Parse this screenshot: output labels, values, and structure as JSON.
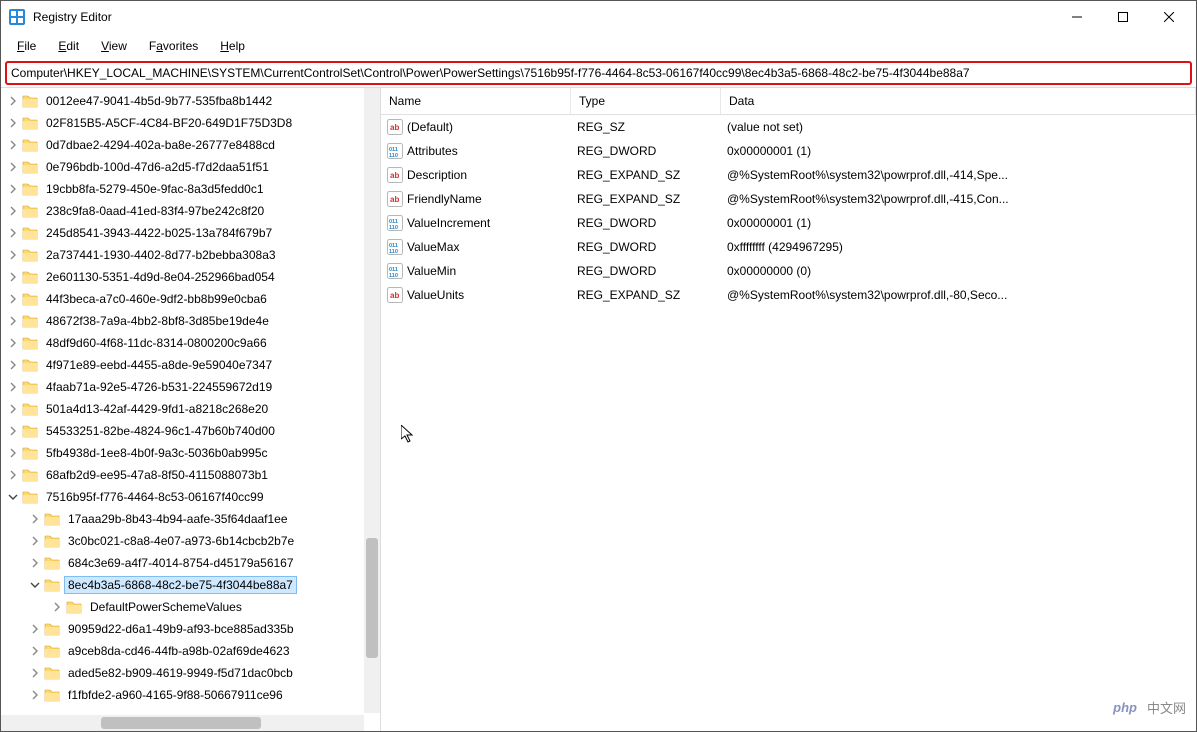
{
  "window": {
    "title": "Registry Editor"
  },
  "menu": {
    "file": "File",
    "edit": "Edit",
    "view": "View",
    "favorites": "Favorites",
    "help": "Help"
  },
  "address": "Computer\\HKEY_LOCAL_MACHINE\\SYSTEM\\CurrentControlSet\\Control\\Power\\PowerSettings\\7516b95f-f776-4464-8c53-06167f40cc99\\8ec4b3a5-6868-48c2-be75-4f3044be88a7",
  "tree": [
    {
      "label": "0012ee47-9041-4b5d-9b77-535fba8b1442",
      "indent": 1,
      "chev": "r"
    },
    {
      "label": "02F815B5-A5CF-4C84-BF20-649D1F75D3D8",
      "indent": 1,
      "chev": "r"
    },
    {
      "label": "0d7dbae2-4294-402a-ba8e-26777e8488cd",
      "indent": 1,
      "chev": "r"
    },
    {
      "label": "0e796bdb-100d-47d6-a2d5-f7d2daa51f51",
      "indent": 1,
      "chev": "r"
    },
    {
      "label": "19cbb8fa-5279-450e-9fac-8a3d5fedd0c1",
      "indent": 1,
      "chev": "r"
    },
    {
      "label": "238c9fa8-0aad-41ed-83f4-97be242c8f20",
      "indent": 1,
      "chev": "r"
    },
    {
      "label": "245d8541-3943-4422-b025-13a784f679b7",
      "indent": 1,
      "chev": "r"
    },
    {
      "label": "2a737441-1930-4402-8d77-b2bebba308a3",
      "indent": 1,
      "chev": "r"
    },
    {
      "label": "2e601130-5351-4d9d-8e04-252966bad054",
      "indent": 1,
      "chev": "r"
    },
    {
      "label": "44f3beca-a7c0-460e-9df2-bb8b99e0cba6",
      "indent": 1,
      "chev": "r"
    },
    {
      "label": "48672f38-7a9a-4bb2-8bf8-3d85be19de4e",
      "indent": 1,
      "chev": "r"
    },
    {
      "label": "48df9d60-4f68-11dc-8314-0800200c9a66",
      "indent": 1,
      "chev": "r"
    },
    {
      "label": "4f971e89-eebd-4455-a8de-9e59040e7347",
      "indent": 1,
      "chev": "r"
    },
    {
      "label": "4faab71a-92e5-4726-b531-224559672d19",
      "indent": 1,
      "chev": "r"
    },
    {
      "label": "501a4d13-42af-4429-9fd1-a8218c268e20",
      "indent": 1,
      "chev": "r"
    },
    {
      "label": "54533251-82be-4824-96c1-47b60b740d00",
      "indent": 1,
      "chev": "r"
    },
    {
      "label": "5fb4938d-1ee8-4b0f-9a3c-5036b0ab995c",
      "indent": 1,
      "chev": "r"
    },
    {
      "label": "68afb2d9-ee95-47a8-8f50-4115088073b1",
      "indent": 1,
      "chev": "r"
    },
    {
      "label": "7516b95f-f776-4464-8c53-06167f40cc99",
      "indent": 1,
      "chev": "d"
    },
    {
      "label": "17aaa29b-8b43-4b94-aafe-35f64daaf1ee",
      "indent": 2,
      "chev": "r"
    },
    {
      "label": "3c0bc021-c8a8-4e07-a973-6b14cbcb2b7e",
      "indent": 2,
      "chev": "r"
    },
    {
      "label": "684c3e69-a4f7-4014-8754-d45179a56167",
      "indent": 2,
      "chev": "r"
    },
    {
      "label": "8ec4b3a5-6868-48c2-be75-4f3044be88a7",
      "indent": 2,
      "chev": "d",
      "selected": true
    },
    {
      "label": "DefaultPowerSchemeValues",
      "indent": 3,
      "chev": "r"
    },
    {
      "label": "90959d22-d6a1-49b9-af93-bce885ad335b",
      "indent": 2,
      "chev": "r"
    },
    {
      "label": "a9ceb8da-cd46-44fb-a98b-02af69de4623",
      "indent": 2,
      "chev": "r"
    },
    {
      "label": "aded5e82-b909-4619-9949-f5d71dac0bcb",
      "indent": 2,
      "chev": "r"
    },
    {
      "label": "f1fbfde2-a960-4165-9f88-50667911ce96",
      "indent": 2,
      "chev": "r"
    }
  ],
  "listheader": {
    "name": "Name",
    "type": "Type",
    "data": "Data"
  },
  "values": [
    {
      "icon": "sz",
      "name": "(Default)",
      "type": "REG_SZ",
      "data": "(value not set)"
    },
    {
      "icon": "dword",
      "name": "Attributes",
      "type": "REG_DWORD",
      "data": "0x00000001 (1)"
    },
    {
      "icon": "sz",
      "name": "Description",
      "type": "REG_EXPAND_SZ",
      "data": "@%SystemRoot%\\system32\\powrprof.dll,-414,Spe..."
    },
    {
      "icon": "sz",
      "name": "FriendlyName",
      "type": "REG_EXPAND_SZ",
      "data": "@%SystemRoot%\\system32\\powrprof.dll,-415,Con..."
    },
    {
      "icon": "dword",
      "name": "ValueIncrement",
      "type": "REG_DWORD",
      "data": "0x00000001 (1)"
    },
    {
      "icon": "dword",
      "name": "ValueMax",
      "type": "REG_DWORD",
      "data": "0xffffffff (4294967295)"
    },
    {
      "icon": "dword",
      "name": "ValueMin",
      "type": "REG_DWORD",
      "data": "0x00000000 (0)"
    },
    {
      "icon": "sz",
      "name": "ValueUnits",
      "type": "REG_EXPAND_SZ",
      "data": "@%SystemRoot%\\system32\\powrprof.dll,-80,Seco..."
    }
  ],
  "watermark": {
    "brand": "php",
    "text": "中文网"
  }
}
